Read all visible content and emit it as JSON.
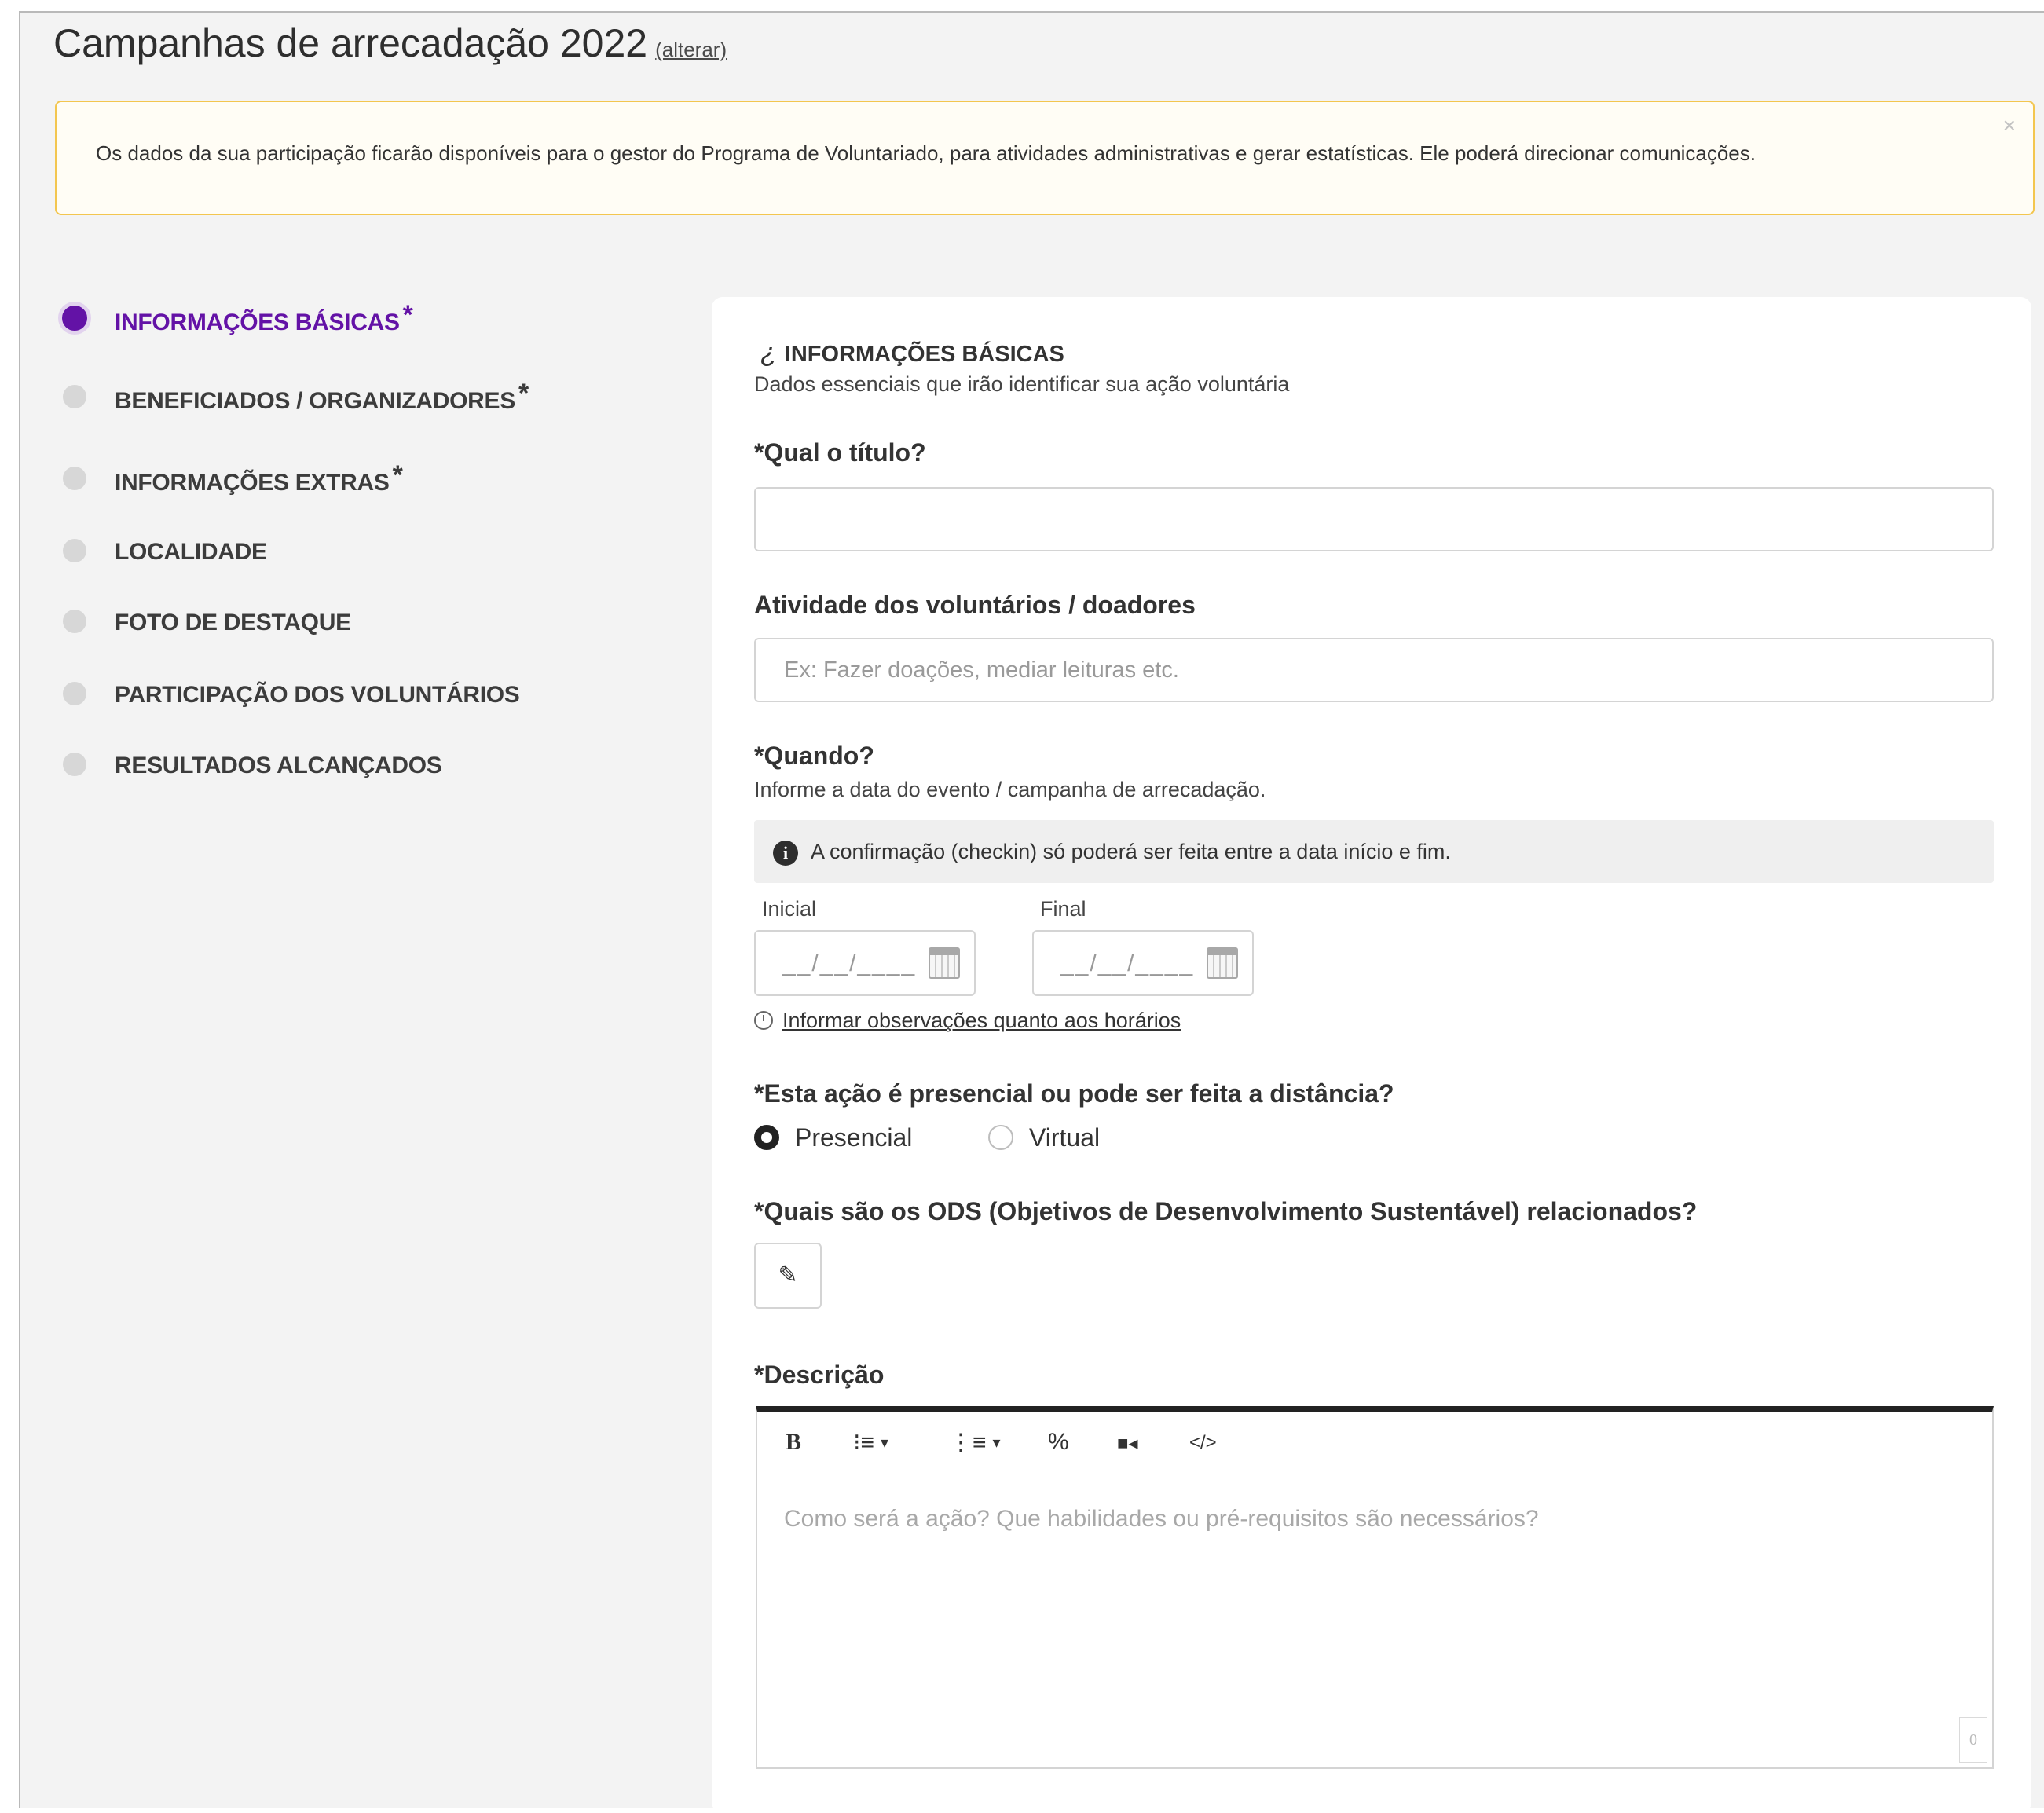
{
  "header": {
    "title": "Campanhas de arrecadação 2022",
    "change_link": "(alterar)"
  },
  "notice": {
    "text": "Os dados da sua participação ficarão disponíveis para o gestor do Programa de Voluntariado, para atividades administrativas e gerar estatísticas. Ele poderá direcionar comunicações.",
    "close": "×"
  },
  "steps": [
    {
      "label": "INFORMAÇÕES BÁSICAS",
      "required": "*",
      "active": true
    },
    {
      "label": "BENEFICIADOS / ORGANIZADORES",
      "required": "*",
      "active": false
    },
    {
      "label": "INFORMAÇÕES EXTRAS",
      "required": "*",
      "active": false
    },
    {
      "label": "LOCALIDADE",
      "required": "",
      "active": false
    },
    {
      "label": "FOTO DE DESTAQUE",
      "required": "",
      "active": false
    },
    {
      "label": "PARTICIPAÇÃO DOS VOLUNTÁRIOS",
      "required": "",
      "active": false
    },
    {
      "label": "RESULTADOS ALCANÇADOS",
      "required": "",
      "active": false
    }
  ],
  "form": {
    "section_icon": "¿",
    "section_title": "INFORMAÇÕES BÁSICAS",
    "section_subtitle": "Dados essenciais que irão identificar sua ação voluntária",
    "title_label": "*Qual o título?",
    "title_value": "",
    "activity_label": "Atividade dos voluntários / doadores",
    "activity_placeholder": "Ex: Fazer doações, mediar leituras etc.",
    "when_label": "*Quando?",
    "when_hint": "Informe a data do evento / campanha de arrecadação.",
    "info_icon": "i",
    "info_text": "A confirmação (checkin) só poderá ser feita entre a data início e fim.",
    "start_label": "Inicial",
    "end_label": "Final",
    "date_mask": "__/__/____",
    "schedule_link": "Informar observações quanto aos horários",
    "mode_label": "*Esta ação é presencial ou pode ser feita a distância?",
    "mode_options": [
      "Presencial",
      "Virtual"
    ],
    "mode_selected": "Presencial",
    "ods_label": "*Quais são os ODS (Objetivos de Desenvolvimento Sustentável) relacionados?",
    "ods_button_icon": "✎",
    "description_label": "*Descrição",
    "description_placeholder": "Como será a ação? Que habilidades ou pré-requisitos são necessários?",
    "char_count": "0"
  },
  "toolbar": {
    "bold": "B",
    "ordered_list": "⁝≡",
    "unordered_list": "⋮≡",
    "caret": "▾",
    "link": "%",
    "video": "■◂",
    "code": "</>"
  },
  "colors": {
    "accent": "#6312a6",
    "notice_border": "#f3c64f",
    "background": "#f3f3f3"
  }
}
